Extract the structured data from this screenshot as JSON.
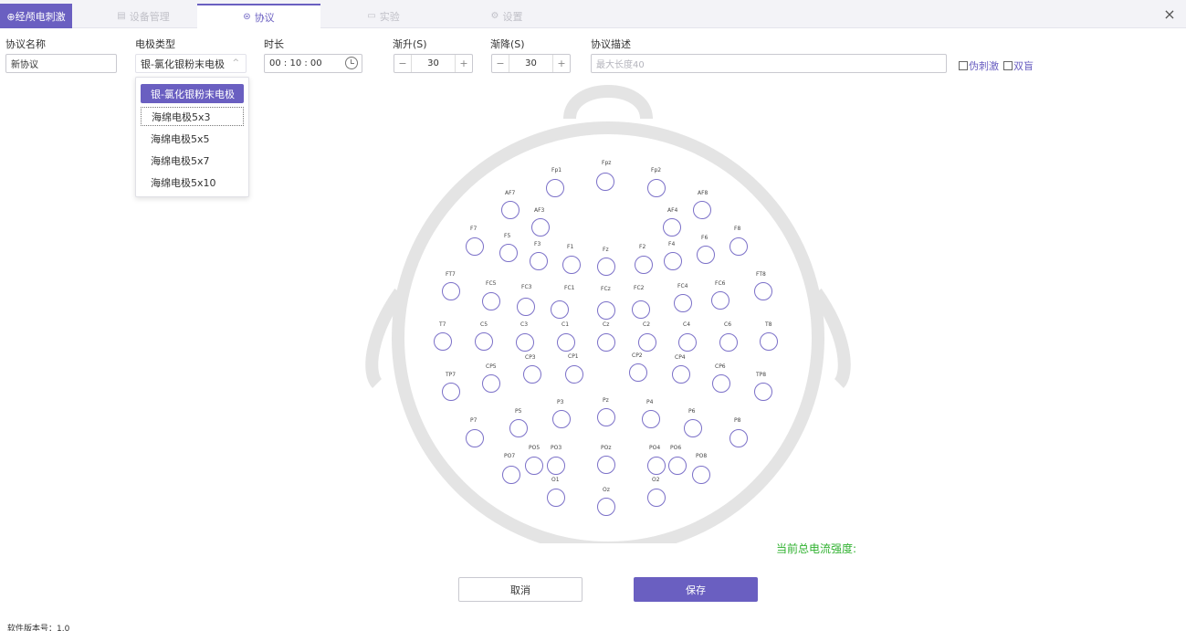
{
  "tabs": {
    "app": "⊕经颅电刺激",
    "device": {
      "icon": "▤",
      "label": "设备管理"
    },
    "protocol": {
      "icon": "⊜",
      "label": "协议"
    },
    "experiment": {
      "icon": "▭",
      "label": "实验"
    },
    "settings": {
      "icon": "⚙",
      "label": "设置"
    },
    "close": "×"
  },
  "form": {
    "name": {
      "label": "协议名称",
      "value": "新协议"
    },
    "electrode_type": {
      "label": "电极类型",
      "value": "银-氯化银粉末电极",
      "caret": "^"
    },
    "duration": {
      "label": "时长",
      "value": "00 : 10 : 00"
    },
    "ramp_up": {
      "label": "渐升(S)",
      "value": "30",
      "minus": "−",
      "plus": "+"
    },
    "ramp_down": {
      "label": "渐降(S)",
      "value": "30",
      "minus": "−",
      "plus": "+"
    },
    "description": {
      "label": "协议描述",
      "placeholder": "最大长度40"
    },
    "sham_label": "伪刺激",
    "double_blind_label": "双盲"
  },
  "dropdown_options": [
    "银-氯化银粉末电极",
    "海绵电极5x3",
    "海绵电极5x5",
    "海绵电极5x7",
    "海绵电极5x10"
  ],
  "electrodes": [
    "Fp1",
    "Fpz",
    "Fp2",
    "AF7",
    "AF3",
    "AF4",
    "AF8",
    "F7",
    "F5",
    "F3",
    "F1",
    "Fz",
    "F2",
    "F4",
    "F6",
    "F8",
    "FT7",
    "FC5",
    "FC3",
    "FC1",
    "FCz",
    "FC2",
    "FC4",
    "FC6",
    "FT8",
    "T7",
    "C5",
    "C3",
    "C1",
    "Cz",
    "C2",
    "C4",
    "C6",
    "T8",
    "CP5",
    "CP3",
    "CP1",
    "CP2",
    "CP4",
    "CP6",
    "TP7",
    "TP8",
    "P7",
    "P5",
    "P3",
    "Pz",
    "P4",
    "P6",
    "P8",
    "PO7",
    "PO5",
    "PO3",
    "POz",
    "PO4",
    "PO6",
    "PO8",
    "O1",
    "Oz",
    "O2"
  ],
  "current_label": "当前总电流强度:",
  "buttons": {
    "cancel": "取消",
    "save": "保存"
  },
  "version": "软件版本号：1.0",
  "colors": {
    "accent": "#6a5fc1",
    "current_text": "#2fb12f"
  }
}
